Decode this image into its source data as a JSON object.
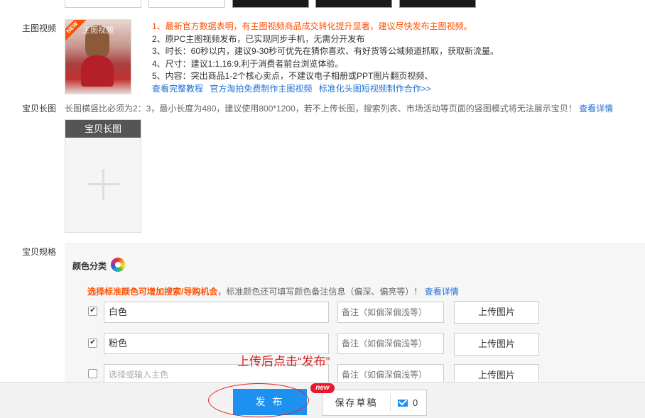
{
  "labels": {
    "main_video": "主图视频",
    "long_image": "宝贝长图",
    "spec": "宝贝规格"
  },
  "video": {
    "thumb_badge": "NEW",
    "thumb_caption": "主图视频",
    "tips": [
      "1、最新官方数据表明，有主图视频商品成交转化提升显著，建议尽快发布主图视频。",
      "2、原PC主图视频发布，已实现同步手机，无需分开发布",
      "3、时长：60秒以内，建议9-30秒可优先在猜你喜欢、有好货等公域频道抓取，获取新流量。",
      "4、尺寸：建议1:1,16:9,利于消费者前台浏览体验。",
      "5、内容：突出商品1-2个核心卖点，不建议电子相册或PPT图片翻页视频、"
    ],
    "links": [
      "查看完整教程",
      "官方淘拍免费制作主图视频",
      "标准化头图短视频制作合作>>"
    ]
  },
  "long_image": {
    "tip": "长图横竖比必须为2：3，最小长度为480，建议使用800*1200，若不上传长图，搜索列表、市场活动等页面的竖图模式将无法展示宝贝！",
    "tip_link": "查看详情",
    "box_title": "宝贝长图"
  },
  "spec": {
    "color_title": "颜色分类",
    "tip_highlight": "选择标准颜色可增加搜索/导购机会",
    "tip_rest": "，标准颜色还可填写颜色备注信息（偏深、偏亮等）！",
    "tip_link": "查看详情",
    "rows": [
      {
        "checked": true,
        "value": "白色",
        "note_placeholder": "备注（如偏深偏浅等）",
        "upload": "上传图片"
      },
      {
        "checked": true,
        "value": "粉色",
        "note_placeholder": "备注（如偏深偏浅等）",
        "upload": "上传图片"
      },
      {
        "checked": false,
        "value": "选择或输入主色",
        "note_placeholder": "备注（如偏深偏浅等）",
        "upload": "上传图片"
      }
    ]
  },
  "annotation": "上传后点击“发布”",
  "footer": {
    "publish": "发 布",
    "draft": "保存草稿",
    "new_badge": "new",
    "msg_count": "0"
  },
  "colors": {
    "accent": "#1e90f0",
    "warn": "#ff5000",
    "annotation": "#e02020",
    "link": "#1f6fd0"
  }
}
